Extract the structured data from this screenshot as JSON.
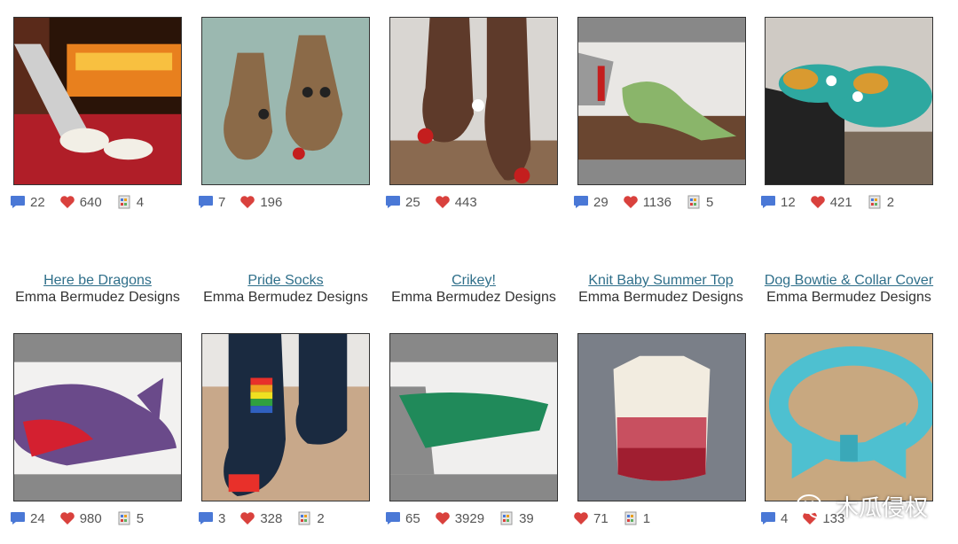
{
  "colors": {
    "link": "#2f6f8a",
    "heart": "#d9413d",
    "comment": "#4a78d6"
  },
  "icons": {
    "comment": "comment-bubble-icon",
    "heart": "heart-icon",
    "projects": "projects-icon"
  },
  "row1_stats": [
    {
      "comments": "22",
      "hearts": "640",
      "projects": "4"
    },
    {
      "comments": "7",
      "hearts": "196"
    },
    {
      "comments": "25",
      "hearts": "443"
    },
    {
      "comments": "29",
      "hearts": "1136",
      "projects": "5"
    },
    {
      "comments": "12",
      "hearts": "421",
      "projects": "2"
    }
  ],
  "row2_cards": [
    {
      "title": "Here be Dragons",
      "designer": "Emma Bermudez Designs",
      "comments": "24",
      "hearts": "980",
      "projects": "5"
    },
    {
      "title": "Pride Socks",
      "designer": "Emma Bermudez Designs",
      "comments": "3",
      "hearts": "328",
      "projects": "2"
    },
    {
      "title": "Crikey!",
      "designer": "Emma Bermudez Designs",
      "comments": "65",
      "hearts": "3929",
      "projects": "39"
    },
    {
      "title": "Knit Baby Summer Top",
      "designer": "Emma Bermudez Designs",
      "hearts": "71",
      "projects": "1"
    },
    {
      "title": "Dog Bowtie & Collar Cover",
      "designer": "Emma Bermudez Designs",
      "comments": "4",
      "hearts": "133"
    }
  ],
  "watermark": {
    "text": "木瓜侵权"
  }
}
